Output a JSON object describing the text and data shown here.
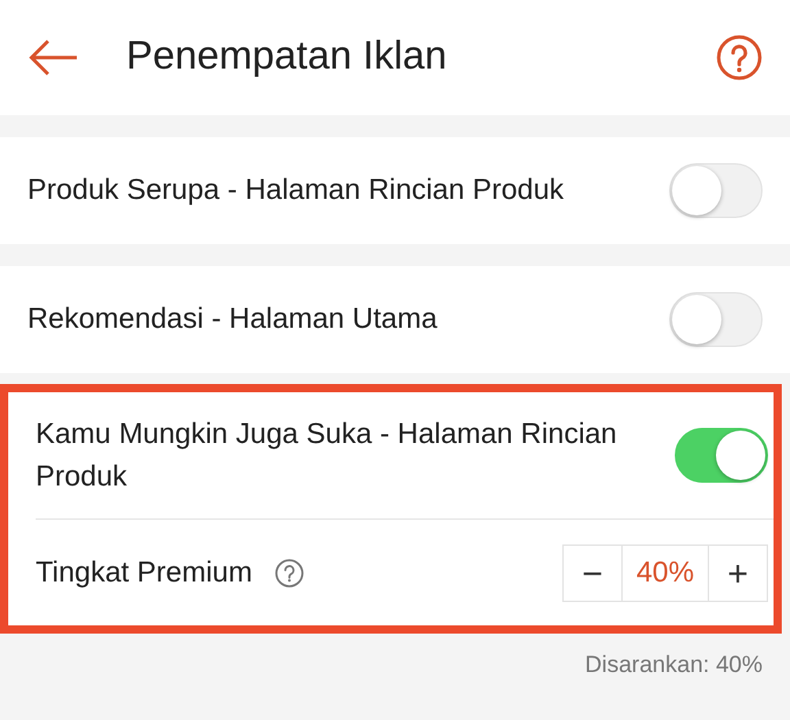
{
  "header": {
    "title": "Penempatan Iklan"
  },
  "placements": [
    {
      "label": "Produk Serupa - Halaman Rincian Produk",
      "on": false,
      "highlighted": false
    },
    {
      "label": "Rekomendasi - Halaman Utama",
      "on": false,
      "highlighted": false
    },
    {
      "label": "Kamu Mungkin Juga Suka - Halaman Rincian Produk",
      "on": true,
      "highlighted": true,
      "premium": {
        "label": "Tingkat Premium",
        "minus": "−",
        "value": "40%",
        "plus": "+"
      }
    }
  ],
  "hint": "Disarankan: 40%"
}
